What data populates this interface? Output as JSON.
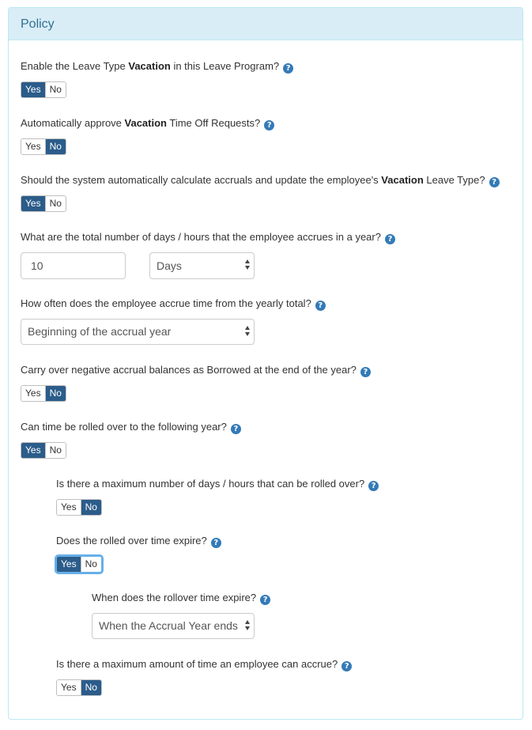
{
  "panel": {
    "title": "Policy"
  },
  "colors": {
    "accent": "#2b5c8a",
    "help": "#337ab7",
    "heading_bg": "#d9edf7",
    "heading_text": "#31708f"
  },
  "questions": {
    "enable": {
      "pre": "Enable the Leave Type ",
      "bold": "Vacation",
      "post": " in this Leave Program?",
      "yes": "Yes",
      "no": "No",
      "selected": "Yes"
    },
    "auto_approve": {
      "pre": "Automatically approve ",
      "bold": "Vacation",
      "post": " Time Off Requests?",
      "yes": "Yes",
      "no": "No",
      "selected": "No"
    },
    "auto_calc": {
      "pre": "Should the system automatically calculate accruals and update the employee's ",
      "bold": "Vacation",
      "post": " Leave Type?",
      "yes": "Yes",
      "no": "No",
      "selected": "Yes"
    },
    "total": {
      "text": "What are the total number of days / hours that the employee accrues in a year?",
      "value": "10",
      "unit": "Days"
    },
    "frequency": {
      "text": "How often does the employee accrue time from the yearly total?",
      "value": "Beginning of the accrual year"
    },
    "carry_negative": {
      "text": "Carry over negative accrual balances as Borrowed at the end of the year?",
      "yes": "Yes",
      "no": "No",
      "selected": "No"
    },
    "rollover": {
      "text": "Can time be rolled over to the following year?",
      "yes": "Yes",
      "no": "No",
      "selected": "Yes"
    },
    "max_rollover": {
      "text": "Is there a maximum number of days / hours that can be rolled over?",
      "yes": "Yes",
      "no": "No",
      "selected": "No"
    },
    "expire": {
      "text": "Does the rolled over time expire?",
      "yes": "Yes",
      "no": "No",
      "selected": "Yes"
    },
    "expire_when": {
      "text": "When does the rollover time expire?",
      "value": "When the Accrual Year ends"
    },
    "max_accrue": {
      "text": "Is there a maximum amount of time an employee can accrue?",
      "yes": "Yes",
      "no": "No",
      "selected": "No"
    }
  },
  "help_glyph": "?"
}
